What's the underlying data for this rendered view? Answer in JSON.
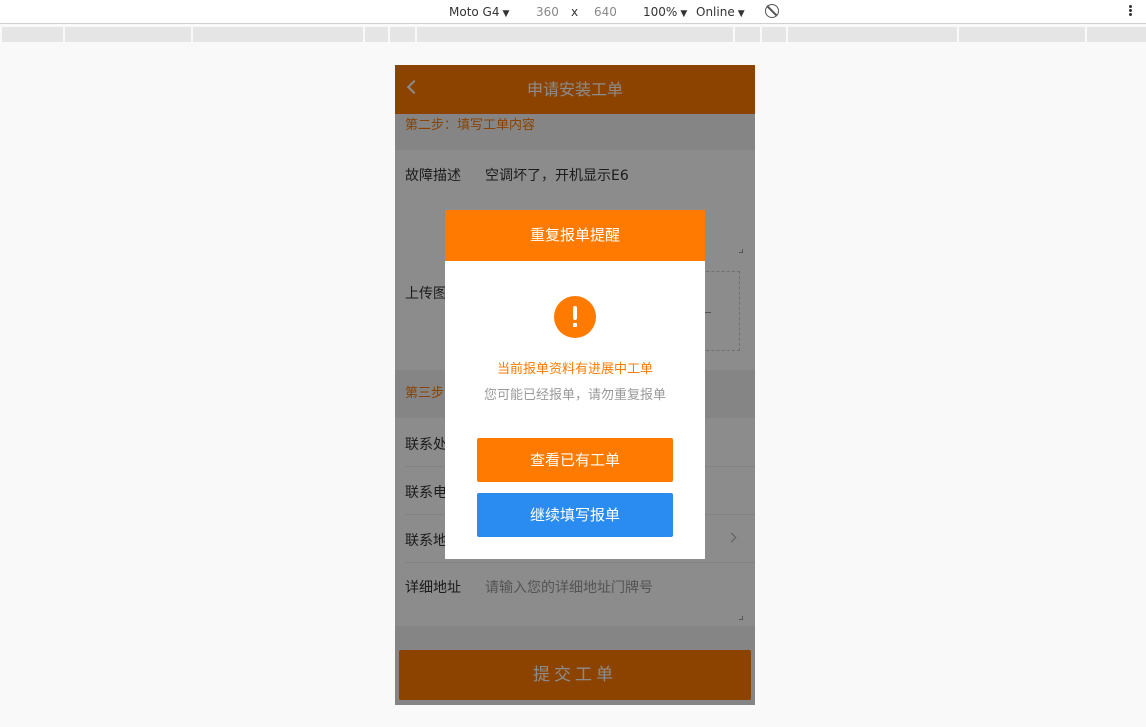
{
  "devtools": {
    "device": "Moto G4",
    "width": "360",
    "times": "x",
    "height": "640",
    "zoom": "100%",
    "network": "Online"
  },
  "header": {
    "title": "申请安装工单"
  },
  "step2": {
    "title": "第二步：填写工单内容",
    "fault_label": "故障描述",
    "fault_value": "空调坏了，开机显示E6",
    "upload_label": "上传图"
  },
  "step3": {
    "title": "第三步",
    "contact_name_label": "联系处",
    "contact_phone_label": "联系电",
    "contact_addr_label": "联系地",
    "detail_label": "详细地址",
    "detail_placeholder": "请输入您的详细地址门牌号"
  },
  "submit_label": "提交工单",
  "dialog": {
    "title": "重复报单提醒",
    "message_primary": "当前报单资料有进展中工单",
    "message_secondary": "您可能已经报单，请勿重复报单",
    "view_button": "查看已有工单",
    "continue_button": "继续填写报单"
  },
  "colors": {
    "accent": "#ff7a00",
    "blue": "#2a8cf0"
  }
}
